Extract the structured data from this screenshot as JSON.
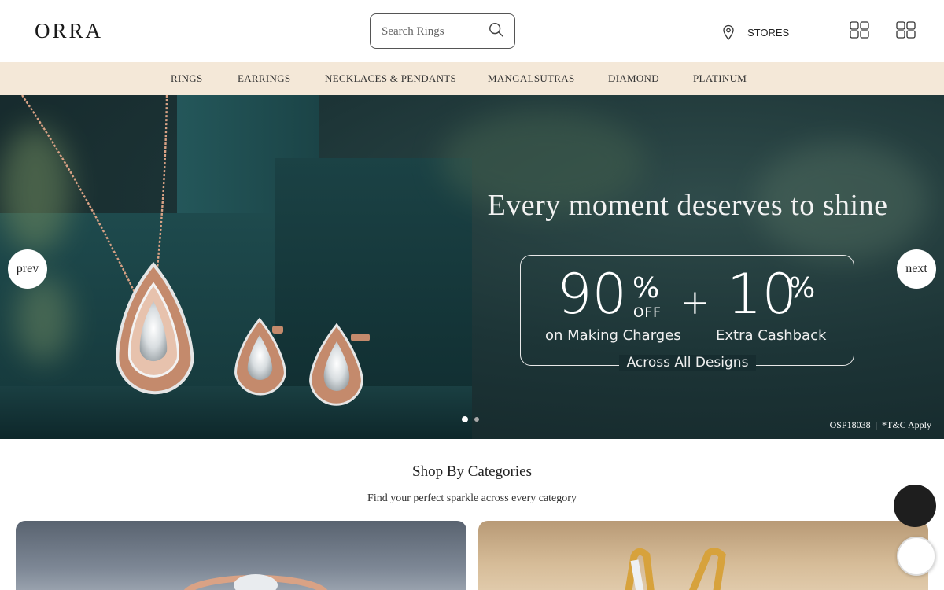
{
  "header": {
    "logo": "ORRA",
    "search_placeholder": "Search Rings",
    "stores_label": "STORES"
  },
  "icons": {
    "search": "search-icon",
    "location": "location-pin-icon",
    "grid_1": "grid-icon",
    "grid_2": "grid-icon"
  },
  "nav": {
    "items": [
      {
        "label": "RINGS"
      },
      {
        "label": "EARRINGS"
      },
      {
        "label": "NECKLACES & PENDANTS"
      },
      {
        "label": "MANGALSUTRAS"
      },
      {
        "label": "DIAMOND"
      },
      {
        "label": "PLATINUM"
      }
    ]
  },
  "hero": {
    "title": "Every moment deserves to shine",
    "offer": {
      "left_num": "90",
      "left_pct": "%",
      "left_off": "OFF",
      "plus": "+",
      "right_num": "10",
      "right_pct": "%",
      "left_sub": "on Making Charges",
      "right_sub": "Extra Cashback",
      "across": "Across All Designs"
    },
    "prev_label": "prev",
    "next_label": "next",
    "legal_code": "OSP18038",
    "legal_sep": "|",
    "legal_tc": "*T&C Apply",
    "slide_count": 2,
    "active_slide": 1
  },
  "categories": {
    "title": "Shop By Categories",
    "subtitle": "Find your perfect sparkle across every category"
  },
  "colors": {
    "nav_bg": "#f4e8d8",
    "hero_bg": "#1d3537",
    "float_dark": "#1e1e1e"
  }
}
